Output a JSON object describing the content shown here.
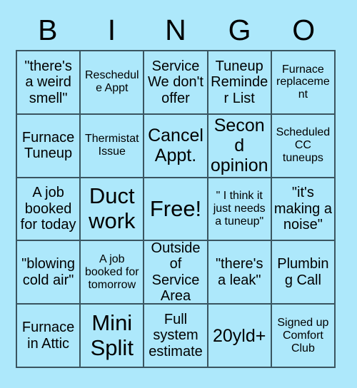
{
  "header": {
    "letters": [
      "B",
      "I",
      "N",
      "G",
      "O"
    ]
  },
  "colors": {
    "background": "#ade8fb",
    "cell_fill": "#ade8fb",
    "grid_line": "#3a5560",
    "text": "#000000"
  },
  "grid": {
    "columns": 5,
    "rows": 5,
    "cells": [
      {
        "text": "\"there's a weird smell\"",
        "size": "md"
      },
      {
        "text": "Reschedule Appt",
        "size": "sm"
      },
      {
        "text": "Service We don't offer",
        "size": "md"
      },
      {
        "text": "Tuneup Reminder List",
        "size": "md"
      },
      {
        "text": "Furnace replacement",
        "size": "sm"
      },
      {
        "text": "Furnace Tuneup",
        "size": "md"
      },
      {
        "text": "Thermistat Issue",
        "size": "sm"
      },
      {
        "text": "Cancel Appt.",
        "size": "lg"
      },
      {
        "text": "Second opinion",
        "size": "lg"
      },
      {
        "text": "Scheduled CC tuneups",
        "size": "sm"
      },
      {
        "text": "A job booked for today",
        "size": "md"
      },
      {
        "text": "Duct work",
        "size": "xl"
      },
      {
        "text": "Free!",
        "size": "xl"
      },
      {
        "text": "\" I think it just needs a tuneup\"",
        "size": "sm"
      },
      {
        "text": "\"it's making a noise\"",
        "size": "md"
      },
      {
        "text": "\"blowing cold air\"",
        "size": "md"
      },
      {
        "text": "A job booked for tomorrow",
        "size": "sm"
      },
      {
        "text": "Outside of Service Area",
        "size": "md"
      },
      {
        "text": "\"there's a leak\"",
        "size": "md"
      },
      {
        "text": "Plumbing Call",
        "size": "md"
      },
      {
        "text": "Furnace in Attic",
        "size": "md"
      },
      {
        "text": "Mini Split",
        "size": "xl"
      },
      {
        "text": "Full system estimate",
        "size": "md"
      },
      {
        "text": "20yld+",
        "size": "lg"
      },
      {
        "text": "Signed up Comfort Club",
        "size": "sm"
      }
    ]
  }
}
